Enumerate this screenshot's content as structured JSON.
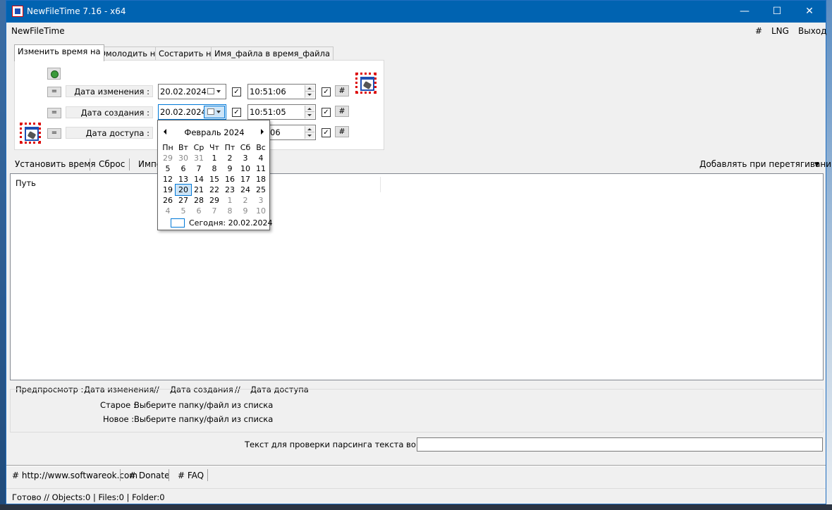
{
  "window": {
    "title": "NewFileTime 7.16 - x64"
  },
  "menu": {
    "app": "NewFileTime",
    "hash": "#",
    "lng": "LNG",
    "exit": "Выход"
  },
  "tabs": [
    "Изменить время на",
    "Омолодить на",
    "Состарить на",
    "Имя_файла в время_файла"
  ],
  "rows": [
    {
      "eq": "=",
      "label": "Дата изменения :",
      "date": "20.02.2024",
      "time": "10:51:06",
      "hash": "#"
    },
    {
      "eq": "=",
      "label": "Дата создания :",
      "date": "20.02.2024",
      "time": "10:51:05",
      "hash": "#"
    },
    {
      "eq": "=",
      "label": "Дата доступа :",
      "date": "",
      "time": "06",
      "hash": "#"
    }
  ],
  "checkmark": "✓",
  "toolbar": {
    "set_time": "Установить время",
    "reset": "Сброс",
    "import": "Импо",
    "drag_add": "Добавлять при перетягивании:",
    "drag_arrow": "▼"
  },
  "list": {
    "column_path": "Путь"
  },
  "preview": {
    "label": "Предпросмотр  :",
    "h_mod": "Дата изменения",
    "sep": "//",
    "h_create": "Дата создания",
    "h_access": "Дата доступа",
    "old_label": "Старое :",
    "old_value": "Выберите папку/файл из списка",
    "new_label": "Новое :",
    "new_value": "Выберите папку/файл из списка"
  },
  "parse": {
    "label": "Текст для проверки парсинга текста во время",
    "value": ""
  },
  "links": {
    "site": "# http://www.softwareok.com",
    "donate": "# Donate",
    "faq": "# FAQ"
  },
  "status": "Готово // Objects:0 | Files:0  | Folder:0",
  "calendar": {
    "title": "Февраль 2024",
    "weekdays": [
      "Пн",
      "Вт",
      "Ср",
      "Чт",
      "Пт",
      "Сб",
      "Вс"
    ],
    "weeks": [
      [
        [
          "29",
          1
        ],
        [
          "30",
          1
        ],
        [
          "31",
          1
        ],
        [
          "1",
          0
        ],
        [
          "2",
          0
        ],
        [
          "3",
          0
        ],
        [
          "4",
          0
        ]
      ],
      [
        [
          "5",
          0
        ],
        [
          "6",
          0
        ],
        [
          "7",
          0
        ],
        [
          "8",
          0
        ],
        [
          "9",
          0
        ],
        [
          "10",
          0
        ],
        [
          "11",
          0
        ]
      ],
      [
        [
          "12",
          0
        ],
        [
          "13",
          0
        ],
        [
          "14",
          0
        ],
        [
          "15",
          0
        ],
        [
          "16",
          0
        ],
        [
          "17",
          0
        ],
        [
          "18",
          0
        ]
      ],
      [
        [
          "19",
          0
        ],
        [
          "20",
          2
        ],
        [
          "21",
          0
        ],
        [
          "22",
          0
        ],
        [
          "23",
          0
        ],
        [
          "24",
          0
        ],
        [
          "25",
          0
        ]
      ],
      [
        [
          "26",
          0
        ],
        [
          "27",
          0
        ],
        [
          "28",
          0
        ],
        [
          "29",
          0
        ],
        [
          "1",
          1
        ],
        [
          "2",
          1
        ],
        [
          "3",
          1
        ]
      ],
      [
        [
          "4",
          1
        ],
        [
          "5",
          1
        ],
        [
          "6",
          1
        ],
        [
          "7",
          1
        ],
        [
          "8",
          1
        ],
        [
          "9",
          1
        ],
        [
          "10",
          1
        ]
      ]
    ],
    "today_text": "Сегодня: 20.02.2024"
  }
}
